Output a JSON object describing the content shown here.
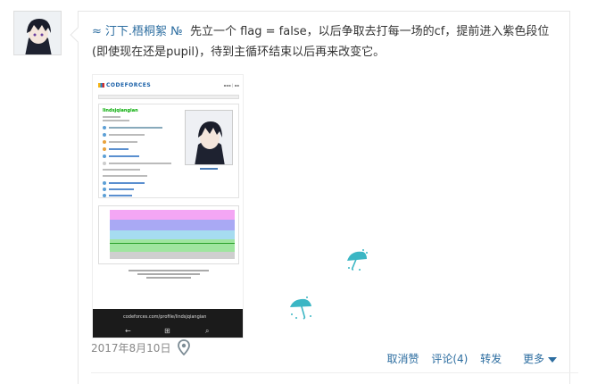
{
  "post": {
    "author": "汀下.梧桐絮 №",
    "text": "先立一个 flag = false，以后争取去打每一场的cf，提前进入紫色段位(即使现在还是pupil)，待到主循环结束以后再来改变它。",
    "date": "2017年8月10日"
  },
  "screenshot": {
    "logo_text": "CODEFORCES",
    "handle": "lindsjqiangian",
    "phone_url": "codeforces.com/profile/lindsjqiangian"
  },
  "actions": {
    "cancel_like": "取消赞",
    "comment": "评论(4)",
    "repost": "转发",
    "more": "更多"
  },
  "icons": {
    "wave": "≈",
    "location": "location-pin-icon",
    "umbrella": "umbrella-icon"
  },
  "colors": {
    "link": "#2c6da0",
    "umbrella": "#3bb6c4"
  }
}
